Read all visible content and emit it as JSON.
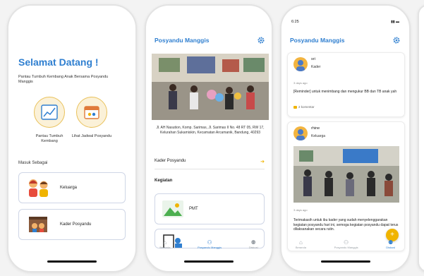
{
  "screen1": {
    "welcome": "Selamat Datang !",
    "subtitle": "Pantau Tumbuh Kembang Anak Bersama Posyandu Manggis",
    "action_growth": "Pantau Tumbuh Kembang",
    "action_schedule": "Lihat Jadwal Posyandu",
    "login_as": "Masuk Sebagai",
    "role_family": "Keluarga",
    "role_kader": "Kader Posyandu"
  },
  "screen2": {
    "title": "Posyandu Manggis",
    "address": "Jl. AH Nasution, Komp. Sarimas, Jl. Sarimas II No. 48 RT 05, RW 17, Kelurahan Sukamiskin, Kecamatan Arcamanik, Bandung, 40293",
    "kader_link": "Kader Posyandu",
    "section_kegiatan": "Kegiatan",
    "activity_1": "PMT",
    "nav": {
      "home": "Beranda",
      "posyandu": "Posyandu Manggis",
      "forum": "Diskusi"
    }
  },
  "screen3": {
    "status_time": "6:25",
    "title": "Posyandu Manggis",
    "posts": [
      {
        "name": "sri",
        "role": "Kader",
        "time": "3 days ago",
        "text": "[Reminder] untuk menimbang dan mengukur BB dan TB anak yah",
        "comments": "2 komentar"
      },
      {
        "name": "rhine",
        "role": "Keluarga",
        "time": "3 days ago",
        "text": "Terimakasih untuk ibu kader yang sudah menyelenggarakan kegiatan posyandu hari ini, semoga kegiatan posyandu dapat terus dilaksanakan secara rutin."
      }
    ],
    "fab": "+",
    "nav": {
      "home": "Beranda",
      "posyandu": "Posyandu Manggis",
      "forum": "Diskusi"
    }
  },
  "colors": {
    "primary": "#2f7fd0",
    "accent": "#f0b400"
  }
}
